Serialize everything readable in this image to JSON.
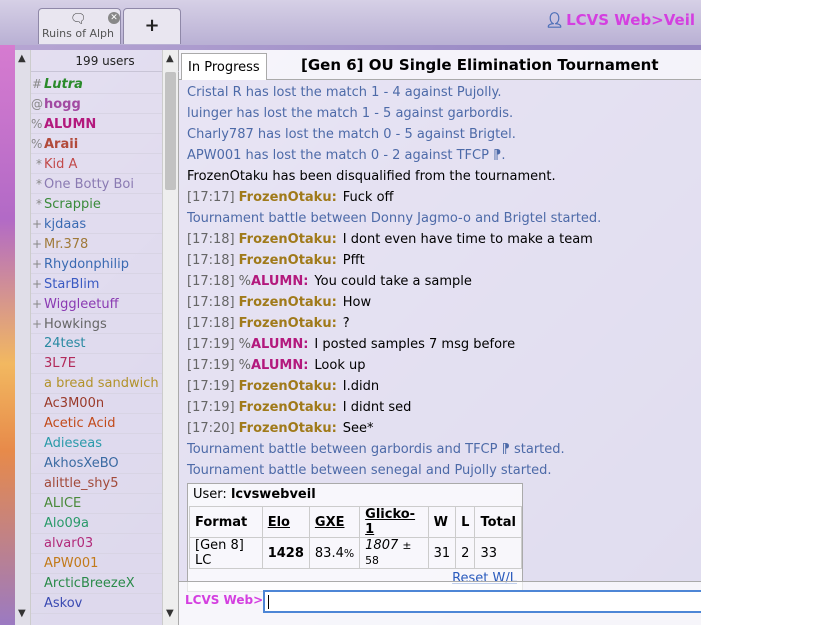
{
  "header": {
    "tab_label": "Ruins of Alph",
    "new_tab": "+",
    "user": "LCVS Web>Veil"
  },
  "userlist": {
    "count": "199 users",
    "users": [
      {
        "sym": "#",
        "name": "Lutra",
        "color": "#2a8a2a",
        "bold": true,
        "italic": true
      },
      {
        "sym": "@",
        "name": "hogg",
        "color": "#a24aa2",
        "bold": true
      },
      {
        "sym": "%",
        "name": "ALUMN",
        "color": "#b3197d",
        "bold": true
      },
      {
        "sym": "%",
        "name": "Araii",
        "color": "#b24a3a",
        "bold": true
      },
      {
        "sym": "*",
        "name": "Kid A",
        "color": "#c24a4a"
      },
      {
        "sym": "*",
        "name": "One Botty Boi",
        "color": "#8a7ab2"
      },
      {
        "sym": "*",
        "name": "Scrappie",
        "color": "#3a8a3a"
      },
      {
        "sym": "+",
        "name": "kjdaas",
        "color": "#3a6ab2"
      },
      {
        "sym": "+",
        "name": "Mr.378",
        "color": "#a07a3a"
      },
      {
        "sym": "+",
        "name": "Rhydonphilip",
        "color": "#3a6ab2"
      },
      {
        "sym": "+",
        "name": "StarBlim",
        "color": "#3a5ac2"
      },
      {
        "sym": "+",
        "name": "Wiggleetuff",
        "color": "#8a3ab2"
      },
      {
        "sym": "+",
        "name": "Howkings",
        "color": "#666"
      },
      {
        "sym": "",
        "name": "24test",
        "color": "#2a8aa2"
      },
      {
        "sym": "",
        "name": "3L7E",
        "color": "#b22a5a"
      },
      {
        "sym": "",
        "name": "a bread sandwich",
        "color": "#b2922a"
      },
      {
        "sym": "",
        "name": "Ac3M00n",
        "color": "#9a3a2a"
      },
      {
        "sym": "",
        "name": "Acetic Acid",
        "color": "#c24a1a"
      },
      {
        "sym": "",
        "name": "Adieseas",
        "color": "#2a9aaa"
      },
      {
        "sym": "",
        "name": "AkhosXeBO",
        "color": "#3a6aa2"
      },
      {
        "sym": "",
        "name": "alittle_shy5",
        "color": "#a24a3a"
      },
      {
        "sym": "",
        "name": "ALICE",
        "color": "#4a8a3a"
      },
      {
        "sym": "",
        "name": "Alo09a",
        "color": "#2a9a6a"
      },
      {
        "sym": "",
        "name": "alvar03",
        "color": "#b22a7a"
      },
      {
        "sym": "",
        "name": "APW001",
        "color": "#c27a1a"
      },
      {
        "sym": "",
        "name": "ArcticBreezeX",
        "color": "#2a8a4a"
      },
      {
        "sym": "",
        "name": "Askov",
        "color": "#3a4ab2"
      }
    ]
  },
  "main": {
    "tab": "In Progress",
    "title": "[Gen 6] OU Single Elimination Tournament",
    "log": [
      {
        "type": "notice",
        "text": "Cristal R has lost the match 1 - 4 against Pujolly."
      },
      {
        "type": "notice",
        "text": "luinger has lost the match 1 - 5 against garbordis."
      },
      {
        "type": "notice",
        "text": "Charly787 has lost the match 0 - 5 against Brigtel."
      },
      {
        "type": "notice",
        "text": "APW001 has lost the match 0 - 2 against TFCP ⁋."
      },
      {
        "type": "plain",
        "text": "FrozenOtaku has been disqualified from the tournament."
      },
      {
        "type": "chat",
        "ts": "[17:17]",
        "rank": "",
        "name": "FrozenOtaku:",
        "color": "#a07a1a",
        "text": "Fuck off"
      },
      {
        "type": "notice",
        "text": "Tournament battle between Donny Jagmo-o and Brigtel started."
      },
      {
        "type": "chat",
        "ts": "[17:18]",
        "rank": "",
        "name": "FrozenOtaku:",
        "color": "#a07a1a",
        "text": "I dont even have time to make a team"
      },
      {
        "type": "chat",
        "ts": "[17:18]",
        "rank": "",
        "name": "FrozenOtaku:",
        "color": "#a07a1a",
        "text": "Pfft"
      },
      {
        "type": "chat",
        "ts": "[17:18]",
        "rank": "%",
        "name": "ALUMN:",
        "color": "#b3197d",
        "text": "You could take a sample"
      },
      {
        "type": "chat",
        "ts": "[17:18]",
        "rank": "",
        "name": "FrozenOtaku:",
        "color": "#a07a1a",
        "text": "How"
      },
      {
        "type": "chat",
        "ts": "[17:18]",
        "rank": "",
        "name": "FrozenOtaku:",
        "color": "#a07a1a",
        "text": "?"
      },
      {
        "type": "chat",
        "ts": "[17:19]",
        "rank": "%",
        "name": "ALUMN:",
        "color": "#b3197d",
        "text": "I posted samples 7 msg before"
      },
      {
        "type": "chat",
        "ts": "[17:19]",
        "rank": "%",
        "name": "ALUMN:",
        "color": "#b3197d",
        "text": "Look up"
      },
      {
        "type": "chat",
        "ts": "[17:19]",
        "rank": "",
        "name": "FrozenOtaku:",
        "color": "#a07a1a",
        "text": "I.didn"
      },
      {
        "type": "chat",
        "ts": "[17:19]",
        "rank": "",
        "name": "FrozenOtaku:",
        "color": "#a07a1a",
        "text": "I didnt sed"
      },
      {
        "type": "chat",
        "ts": "[17:20]",
        "rank": "",
        "name": "FrozenOtaku:",
        "color": "#a07a1a",
        "text": "See*"
      },
      {
        "type": "notice",
        "text": "Tournament battle between garbordis and TFCP ⁋ started."
      },
      {
        "type": "notice",
        "text": "Tournament battle between senegal and Pujolly started."
      }
    ],
    "stats": {
      "user_label": "User:",
      "user": "lcvswebveil",
      "headers": [
        "Format",
        "Elo",
        "GXE",
        "Glicko-1",
        "W",
        "L",
        "Total"
      ],
      "row": {
        "format": "[Gen 8] LC",
        "elo": "1428",
        "gxe": "83.4",
        "gxe_pct": "%",
        "glicko": "1807",
        "glicko_pm": "± 58",
        "w": "31",
        "l": "2",
        "total": "33"
      },
      "reset": "Reset W/L"
    },
    "input_prompt": "LCVS Web>"
  }
}
